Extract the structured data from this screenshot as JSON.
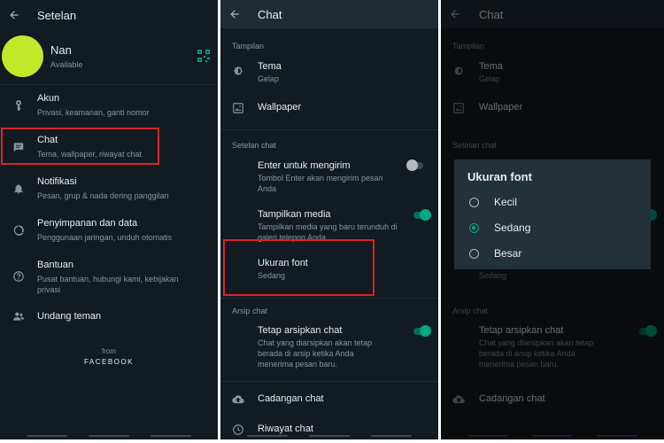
{
  "settings": {
    "title": "Setelan",
    "profile": {
      "name": "Nan",
      "status": "Available",
      "avatar_color": "#c3e82a"
    },
    "items": [
      {
        "title": "Akun",
        "sub": "Privasi, keamanan, ganti nomor",
        "icon": "key-icon"
      },
      {
        "title": "Chat",
        "sub": "Tema, wallpaper, riwayat chat",
        "icon": "chat-icon"
      },
      {
        "title": "Notifikasi",
        "sub": "Pesan, grup & nada dering panggilan",
        "icon": "bell-icon"
      },
      {
        "title": "Penyimpanan dan data",
        "sub": "Penggunaan jaringan, unduh otomatis",
        "icon": "data-usage-icon"
      },
      {
        "title": "Bantuan",
        "sub": "Pusat bantuan, hubungi kami, kebijakan privasi",
        "icon": "help-icon"
      },
      {
        "title": "Undang teman",
        "icon": "people-icon"
      }
    ],
    "footer_from": "from",
    "footer_brand": "FACEBOOK"
  },
  "chat": {
    "title": "Chat",
    "section_display": "Tampilan",
    "theme": {
      "title": "Tema",
      "sub": "Gelap"
    },
    "wallpaper": "Wallpaper",
    "section_chat_settings": "Setelan chat",
    "enter_send": {
      "title": "Enter untuk mengirim",
      "sub": "Tombol Enter akan mengirim pesan Anda",
      "enabled": false
    },
    "media_visibility": {
      "title": "Tampilkan media",
      "sub": "Tampilkan media yang baru terunduh di galeri telepon Anda",
      "enabled": true
    },
    "font_size": {
      "title": "Ukuran font",
      "sub": "Sedang"
    },
    "section_archive": "Arsip chat",
    "keep_archived": {
      "title": "Tetap arsipkan chat",
      "sub": "Chat yang diarsipkan akan tetap berada di arsip ketika Anda menerima pesan baru.",
      "enabled": true
    },
    "backup": "Cadangan chat",
    "history": "Riwayat chat"
  },
  "font_dialog": {
    "title": "Ukuran font",
    "options": [
      {
        "label": "Kecil",
        "selected": false
      },
      {
        "label": "Sedang",
        "selected": true
      },
      {
        "label": "Besar",
        "selected": false
      }
    ]
  },
  "colors": {
    "background": "#121b22",
    "accent": "#00a884",
    "highlight_box": "#d9232d",
    "dialog": "#233138"
  }
}
